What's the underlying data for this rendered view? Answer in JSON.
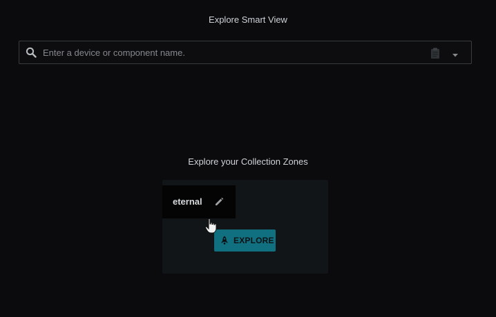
{
  "header": {
    "title": "Explore Smart View"
  },
  "search": {
    "placeholder": "Enter a device or component name.",
    "value": "",
    "icons": [
      "search-icon",
      "clipboard-icon",
      "chevron-down-icon"
    ]
  },
  "zones": {
    "title": "Explore your Collection Zones",
    "items": [
      {
        "name": "eternal",
        "edit_icon": "pencil-icon",
        "button_label": "EXPLORE",
        "button_icon": "rocket-icon"
      }
    ]
  },
  "cursor": {
    "icon": "hand-pointer-icon"
  },
  "colors": {
    "background": "#0b0b0d",
    "accent": "#11707f",
    "card": "#111518"
  }
}
